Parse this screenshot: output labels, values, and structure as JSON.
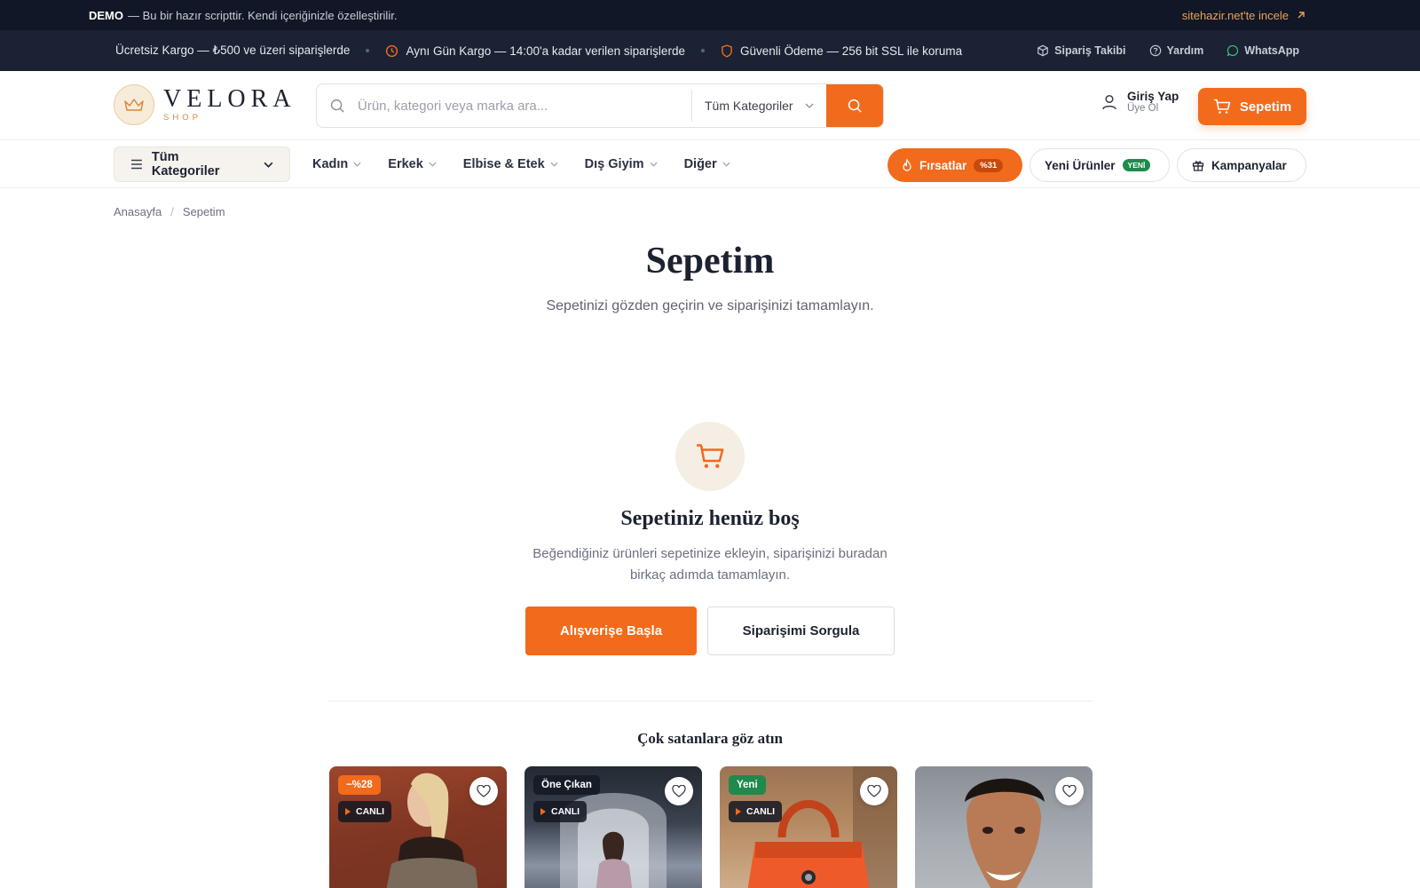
{
  "demo_bar": {
    "label": "DEMO",
    "text": "— Bu bir hazır scripttir. Kendi içeriğinizle özelleştirilir.",
    "link": "sitehazir.net'te incele"
  },
  "promo_bar": {
    "items": [
      "Ücretsiz Kargo — ₺500 ve üzeri siparişlerde",
      "Aynı Gün Kargo — 14:00'a kadar verilen siparişlerde",
      "Güvenli Ödeme — 256 bit SSL ile koruma"
    ],
    "order_tracking": "Sipariş Takibi",
    "help": "Yardım",
    "whatsapp": "WhatsApp"
  },
  "header": {
    "logo_name": "VELORA",
    "logo_sub": "SHOP",
    "search_placeholder": "Ürün, kategori veya marka ara...",
    "search_category": "Tüm Kategoriler",
    "login_main": "Giriş Yap",
    "login_sub": "Üye Ol",
    "cart_label": "Sepetim"
  },
  "nav": {
    "all_categories": "Tüm Kategoriler",
    "links": [
      "Kadın",
      "Erkek",
      "Elbise & Etek",
      "Dış Giyim",
      "Diğer"
    ],
    "deals": "Fırsatlar",
    "deals_tag": "%31",
    "new_products": "Yeni Ürünler",
    "new_tag": "YENİ",
    "campaigns": "Kampanyalar"
  },
  "breadcrumb": {
    "home": "Anasayfa",
    "separator": "/",
    "current": "Sepetim"
  },
  "page": {
    "title": "Sepetim",
    "subtitle": "Sepetinizi gözden geçirin ve siparişinizi tamamlayın."
  },
  "empty_cart": {
    "title": "Sepetiniz henüz boş",
    "description": "Beğendiğiniz ürünleri sepetinize ekleyin, siparişinizi buradan birkaç adımda tamamlayın.",
    "start_button": "Alışverişe Başla",
    "track_button": "Siparişimi Sorgula"
  },
  "bestsellers": {
    "title": "Çok satanlara göz atın",
    "products": [
      {
        "badge": "−%28",
        "live": "CANLI"
      },
      {
        "badge": "Öne Çıkan",
        "live": "CANLI"
      },
      {
        "badge": "Yeni",
        "live": "CANLI"
      },
      {
        "badge": "",
        "live": ""
      }
    ]
  },
  "colors": {
    "accent": "#f26a1b",
    "dark": "#111726",
    "success": "#1f8a4c"
  },
  "icons": [
    "arrow-up-right-icon",
    "clock-icon",
    "shield-icon",
    "box-icon",
    "help-icon",
    "whatsapp-icon",
    "crown-icon",
    "search-icon",
    "chevron-down-icon",
    "user-icon",
    "cart-icon",
    "menu-icon",
    "flame-icon",
    "gift-icon",
    "heart-icon",
    "play-icon"
  ]
}
